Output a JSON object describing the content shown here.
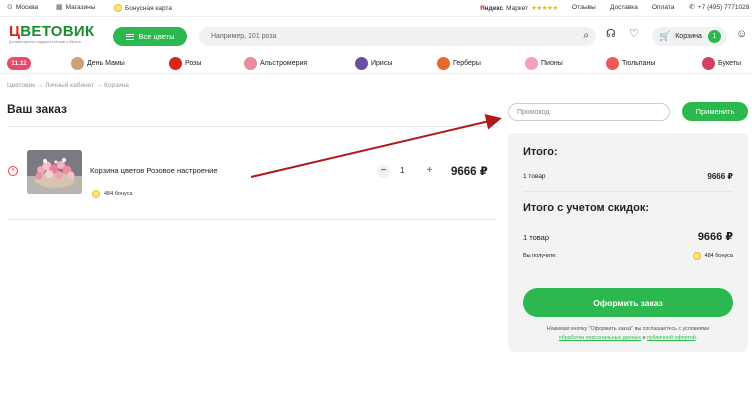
{
  "topbar": {
    "city": "Москва",
    "shops": "Магазины",
    "bonus_card": "Бонусная карта",
    "ym_prefix": "Я",
    "ym_rest": "ндекс",
    "ym_market": "Маркет",
    "stars": "★★★★★",
    "reviews": "Отзывы",
    "delivery": "Доставка",
    "payment": "Оплата",
    "phone": "+7 (495) 7771028"
  },
  "header": {
    "logo_first": "Ц",
    "logo_rest": "ВЕТОВИК",
    "logo_sub": "Доставка цветов и подарков в Москве и области",
    "all_flowers": "Все цветы",
    "search_placeholder": "Например, 101 роза",
    "cart_label": "Корзина",
    "cart_count": "1"
  },
  "categories": {
    "sale": "11.11",
    "items": [
      {
        "label": "День Мамы",
        "color": "#c9a27a"
      },
      {
        "label": "Розы",
        "color": "#d8232a"
      },
      {
        "label": "Альстромерия",
        "color": "#e88aa0"
      },
      {
        "label": "Ирисы",
        "color": "#6a4fa0"
      },
      {
        "label": "Герберы",
        "color": "#e8672a"
      },
      {
        "label": "Пионы",
        "color": "#f2a2b8"
      },
      {
        "label": "Тюльпаны",
        "color": "#e85a5a"
      },
      {
        "label": "Букеты",
        "color": "#d04060"
      }
    ]
  },
  "breadcrumbs": "Цветовик → Личный кабинет → Корзина",
  "page_title": "Ваш заказ",
  "promo": {
    "placeholder": "Промокод",
    "apply": "Применить"
  },
  "cart_item": {
    "name": "Корзина цветов Розовое настроение",
    "bonus": "484 бонуса",
    "quantity": "1",
    "price": "9666 ₽",
    "minus": "−",
    "plus": "+",
    "remove": "×"
  },
  "summary": {
    "total_title": "Итого:",
    "items_count": "1 товар",
    "total_price": "9666 ₽",
    "discount_title": "Итого с учетом скидок:",
    "items_count_2": "1 товар",
    "discount_price": "9666 ₽",
    "you_get": "Вы получите:",
    "bonus": "484 бонуса",
    "checkout": "Оформить заказ",
    "legal_text": "Нажимая кнопку \"Оформить заказ\" вы соглашаетесь с условиями",
    "legal_link1": "обработки персональных данных",
    "legal_and": " и ",
    "legal_link2": "публичной офертой",
    "legal_dot": "."
  },
  "colors": {
    "accent": "#2cb84f",
    "sale": "#e84a6a",
    "annotation_arrow": "#b01a1a"
  }
}
